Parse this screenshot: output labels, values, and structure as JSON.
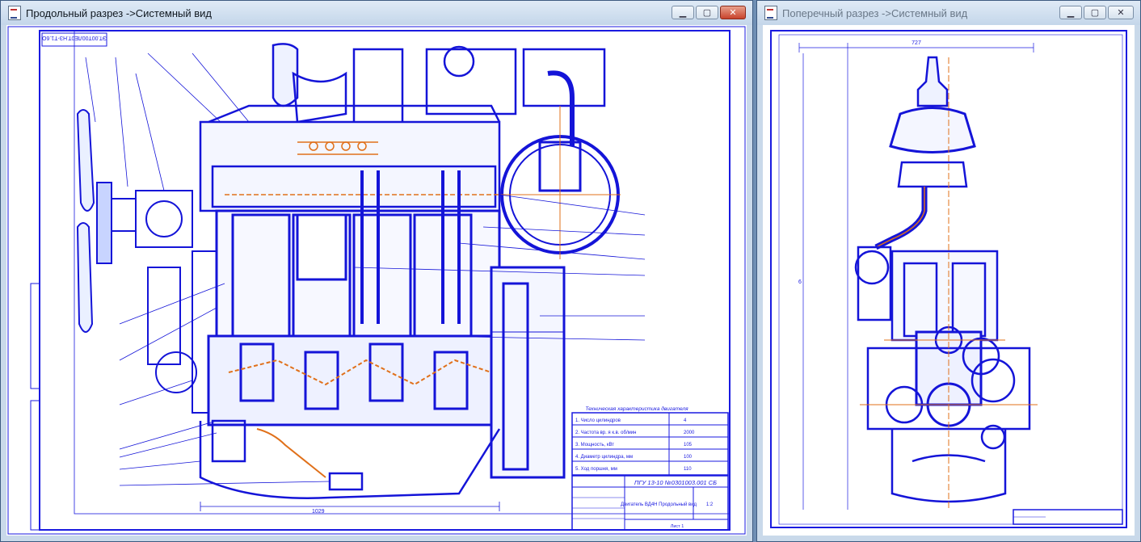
{
  "windows": [
    {
      "title": "Продольный разрез ->Системный вид",
      "controls": {
        "minimize": "▁",
        "maximize": "▢",
        "close": "✕"
      }
    },
    {
      "title": "Поперечный разрез ->Системный вид",
      "controls": {
        "minimize": "▁",
        "maximize": "▢",
        "close": "✕"
      }
    }
  ],
  "drawing_left": {
    "top_stamp": "ЭТ.00Т00ЛЕ0Т.НЗ-Т1.6О",
    "bottom_dimension": "1029",
    "spec_table": {
      "title": "Техническая характеристика двигателя",
      "rows": [
        {
          "label": "1. Число цилиндров",
          "value": "4"
        },
        {
          "label": "2. Частота вр. я к.в. об/мин",
          "value": "2000"
        },
        {
          "label": "3. Мощность, кВт",
          "value": "105"
        },
        {
          "label": "4. Диаметр цилиндра, мм",
          "value": "100"
        },
        {
          "label": "5. Ход поршня, мм",
          "value": "110"
        }
      ]
    },
    "title_block": {
      "doc_number": "ПГУ 13-10 №0301003.001 СБ",
      "name": "Двигатель ВД4Н Продольный вид",
      "scale": "1:2",
      "sheet": "Лист 1"
    }
  },
  "drawing_right": {
    "top_dimension": "727",
    "side_dimension": "6"
  },
  "colors": {
    "line": "#1414d8",
    "accent": "#e0701a",
    "paper": "#ffffff",
    "frame": "#1a1ae0"
  }
}
